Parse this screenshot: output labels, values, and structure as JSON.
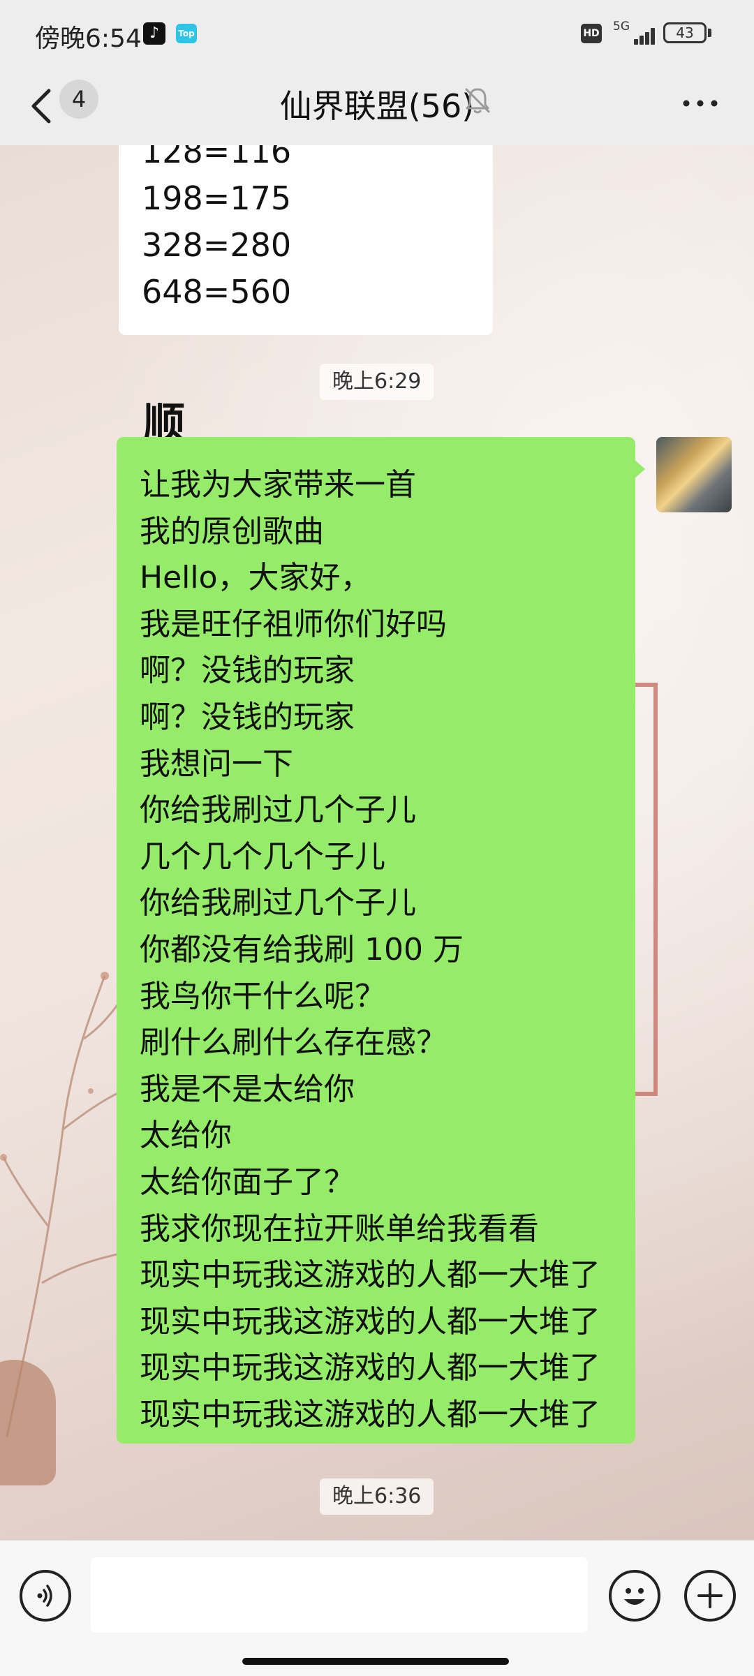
{
  "status_bar": {
    "time": "傍晚6:54",
    "app_badge_top": "Top",
    "hd": "HD",
    "network": "5G",
    "battery": "43"
  },
  "header": {
    "unread_count": "4",
    "title": "仙界联盟(56)"
  },
  "messages": {
    "price_lines": [
      "128=116",
      "198=175",
      "328=280",
      "648=560"
    ],
    "timestamp_1": "晚上6:29",
    "sender_fragment": "顺",
    "lyrics": [
      "让我为大家带来一首",
      "我的原创歌曲",
      "Hello，大家好，",
      "我是旺仔祖师你们好吗",
      "啊？没钱的玩家",
      "啊？没钱的玩家",
      "我想问一下",
      "你给我刷过几个子儿",
      "几个几个几个子儿",
      "你给我刷过几个子儿",
      "你都没有给我刷 100 万",
      "我鸟你干什么呢？",
      "刷什么刷什么存在感？",
      "我是不是太给你",
      "太给你",
      "太给你面子了？",
      "我求你现在拉开账单给我看看",
      "现实中玩我这游戏的人都一大堆了",
      "现实中玩我这游戏的人都一大堆了",
      "现实中玩我这游戏的人都一大堆了",
      "现实中玩我这游戏的人都一大堆了"
    ],
    "timestamp_2": "晚上6:36"
  },
  "input": {
    "value": "",
    "placeholder": ""
  },
  "icons": {
    "back": "back-chevron-icon",
    "mute": "bell-off-icon",
    "more": "more-dots-icon",
    "voice": "voice-icon",
    "emoji": "emoji-icon",
    "plus": "plus-icon"
  },
  "colors": {
    "bubble_green": "#95ec69",
    "bubble_white": "#ffffff",
    "bar_bg": "#ededed"
  }
}
